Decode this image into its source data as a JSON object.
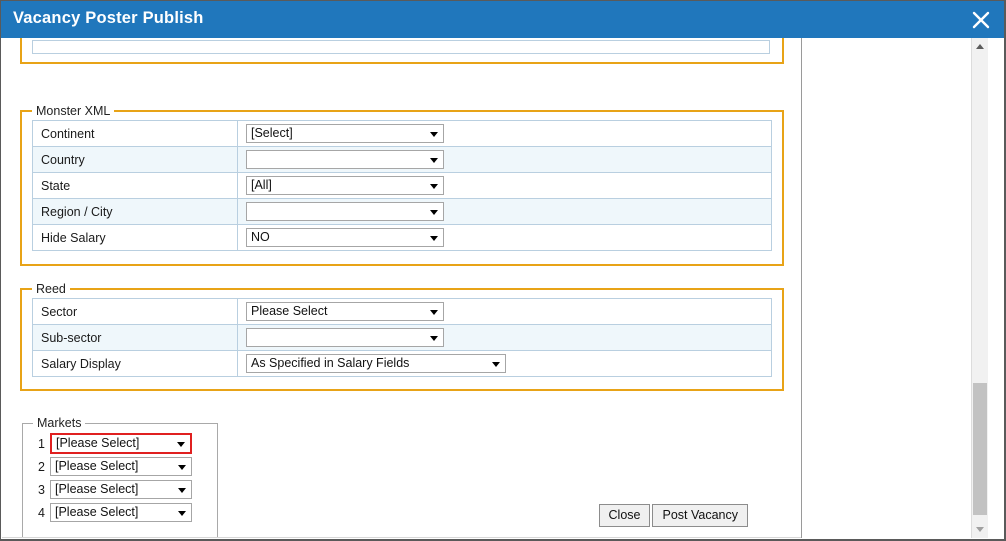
{
  "window": {
    "title": "Vacancy Poster Publish",
    "close_icon": "close-icon",
    "accent_color": "#2077bc",
    "fieldset_accent_color": "#e8a317",
    "validation_color": "#e02020"
  },
  "scrollbar": {
    "up_icon": "triangle-up-icon",
    "down_icon": "triangle-down-icon",
    "thumb": "scroll-thumb"
  },
  "sections": {
    "monster_xml": {
      "legend": "Monster XML",
      "rows": [
        {
          "label": "Continent",
          "value": "[Select]",
          "width": "w198"
        },
        {
          "label": "Country",
          "value": "",
          "width": "w198"
        },
        {
          "label": "State",
          "value": "[All]",
          "width": "w198"
        },
        {
          "label": "Region / City",
          "value": "",
          "width": "w198"
        },
        {
          "label": "Hide Salary",
          "value": "NO",
          "width": "w198"
        }
      ]
    },
    "reed": {
      "legend": "Reed",
      "rows": [
        {
          "label": "Sector",
          "value": "Please Select",
          "width": "w198"
        },
        {
          "label": "Sub-sector",
          "value": "",
          "width": "w198"
        },
        {
          "label": "Salary Display",
          "value": "As Specified in Salary Fields",
          "width": "w260"
        }
      ]
    },
    "markets": {
      "legend": "Markets",
      "rows": [
        {
          "num": "1",
          "value": "[Please Select]",
          "highlighted": true
        },
        {
          "num": "2",
          "value": "[Please Select]",
          "highlighted": false
        },
        {
          "num": "3",
          "value": "[Please Select]",
          "highlighted": false
        },
        {
          "num": "4",
          "value": "[Please Select]",
          "highlighted": false
        }
      ]
    }
  },
  "buttons": {
    "close": "Close",
    "post_vacancy": "Post Vacancy"
  }
}
